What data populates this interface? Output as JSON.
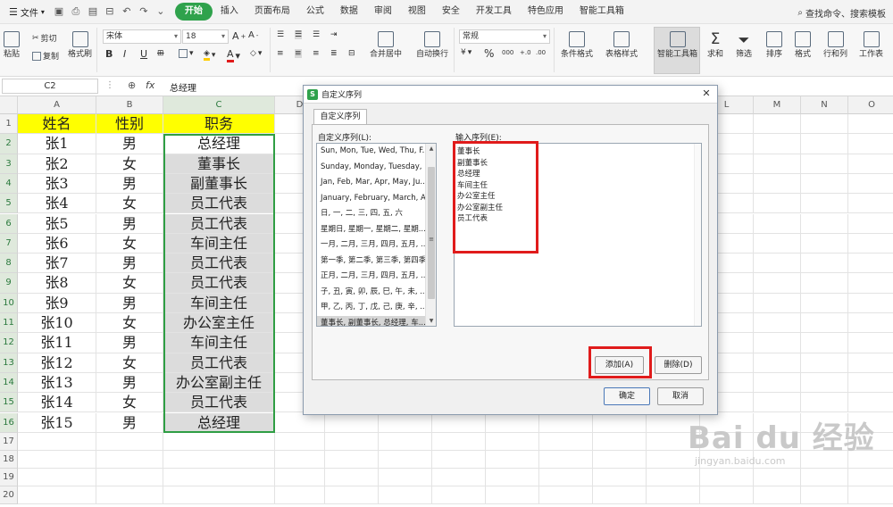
{
  "menubar": {
    "file_label": "文件",
    "tabs": [
      "开始",
      "插入",
      "页面布局",
      "公式",
      "数据",
      "审阅",
      "视图",
      "安全",
      "开发工具",
      "特色应用",
      "智能工具箱"
    ],
    "active_tab": "开始",
    "search_label": "查找命令、搜索模板"
  },
  "ribbon": {
    "paste": "粘贴",
    "cut": "剪切",
    "copy": "复制",
    "format_painter": "格式刷",
    "font_name": "宋体",
    "font_size": "18",
    "bold": "B",
    "italic": "I",
    "underline": "U",
    "merge_center": "合并居中",
    "wrap_text": "自动换行",
    "number_format": "常规",
    "percent": "%",
    "cond_format": "条件格式",
    "table_style": "表格样式",
    "smart_toolbox": "智能工具箱",
    "sum": "求和",
    "filter": "筛选",
    "sort": "排序",
    "format": "格式",
    "row_col": "行和列",
    "worksheet": "工作表"
  },
  "formula_bar": {
    "name_box": "C2",
    "fx": "fx",
    "value": "总经理"
  },
  "sheet": {
    "columns": [
      "A",
      "B",
      "C",
      "D",
      "E",
      "F",
      "G",
      "H",
      "I",
      "J",
      "K",
      "L",
      "M",
      "N",
      "O",
      "P"
    ],
    "row_numbers": [
      "1",
      "2",
      "3",
      "4",
      "5",
      "6",
      "7",
      "8",
      "9",
      "10",
      "11",
      "12",
      "13",
      "14",
      "15",
      "16",
      "17",
      "18",
      "19",
      "20"
    ],
    "headers": [
      "姓名",
      "性别",
      "职务"
    ],
    "rows": [
      [
        "张1",
        "男",
        "总经理"
      ],
      [
        "张2",
        "女",
        "董事长"
      ],
      [
        "张3",
        "男",
        "副董事长"
      ],
      [
        "张4",
        "女",
        "员工代表"
      ],
      [
        "张5",
        "男",
        "员工代表"
      ],
      [
        "张6",
        "女",
        "车间主任"
      ],
      [
        "张7",
        "男",
        "员工代表"
      ],
      [
        "张8",
        "女",
        "员工代表"
      ],
      [
        "张9",
        "男",
        "车间主任"
      ],
      [
        "张10",
        "女",
        "办公室主任"
      ],
      [
        "张11",
        "男",
        "车间主任"
      ],
      [
        "张12",
        "女",
        "员工代表"
      ],
      [
        "张13",
        "男",
        "办公室副主任"
      ],
      [
        "张14",
        "女",
        "员工代表"
      ],
      [
        "张15",
        "男",
        "总经理"
      ]
    ]
  },
  "dialog": {
    "title": "自定义序列",
    "tab": "自定义序列",
    "list_label": "自定义序列(L):",
    "entry_label": "输入序列(E):",
    "lists": [
      "Sun, Mon, Tue, Wed, Thu, F...",
      "Sunday, Monday, Tuesday, ...",
      "Jan, Feb, Mar, Apr, May, Ju...",
      "January, February, March, A...",
      "日, 一, 二, 三, 四, 五, 六",
      "星期日, 星期一, 星期二, 星期...",
      "一月, 二月, 三月, 四月, 五月, ...",
      "第一季, 第二季, 第三季, 第四季",
      "正月, 二月, 三月, 四月, 五月, ...",
      "子, 丑, 寅, 卯, 辰, 巳, 午, 未, ...",
      "甲, 乙, 丙, 丁, 戊, 己, 庚, 辛, ...",
      "董事长, 副董事长, 总经理, 车..."
    ],
    "entries": [
      "董事长",
      "副董事长",
      "总经理",
      "车间主任",
      "办公室主任",
      "办公室副主任",
      "员工代表"
    ],
    "add_button": "添加(A)",
    "delete_button": "删除(D)",
    "ok_button": "确定",
    "cancel_button": "取消"
  },
  "watermark": {
    "brand": "Bai du 经验",
    "url": "jingyan.baidu.com"
  }
}
